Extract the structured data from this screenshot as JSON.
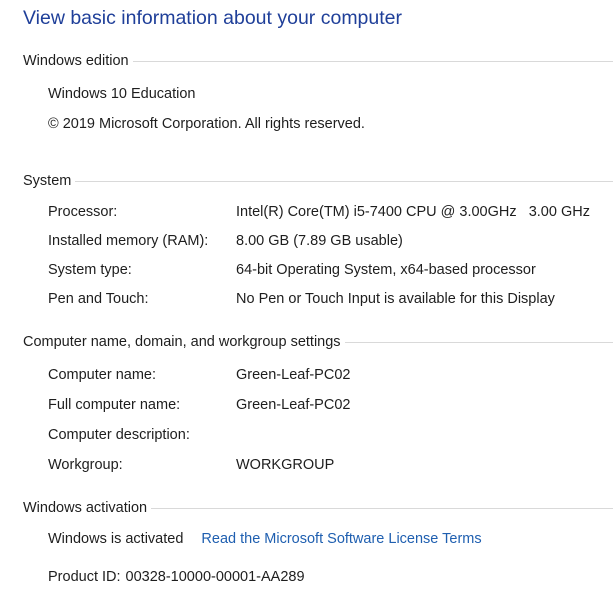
{
  "page_title": "View basic information about your computer",
  "windows_edition": {
    "header": "Windows edition",
    "edition": "Windows 10 Education",
    "copyright": "© 2019 Microsoft Corporation. All rights reserved."
  },
  "system": {
    "header": "System",
    "rows": [
      {
        "key": "Processor:",
        "value": "Intel(R) Core(TM) i5-7400 CPU @ 3.00GHz   3.00 GHz"
      },
      {
        "key": "Installed memory (RAM):",
        "value": "8.00 GB (7.89 GB usable)"
      },
      {
        "key": "System type:",
        "value": "64-bit Operating System, x64-based processor"
      },
      {
        "key": "Pen and Touch:",
        "value": "No Pen or Touch Input is available for this Display"
      }
    ]
  },
  "computer_name": {
    "header": "Computer name, domain, and workgroup settings",
    "rows": [
      {
        "key": "Computer name:",
        "value": "Green-Leaf-PC02"
      },
      {
        "key": "Full computer name:",
        "value": "Green-Leaf-PC02"
      },
      {
        "key": "Computer description:",
        "value": ""
      },
      {
        "key": "Workgroup:",
        "value": "WORKGROUP"
      }
    ]
  },
  "activation": {
    "header": "Windows activation",
    "status": "Windows is activated",
    "license_link": "Read the Microsoft Software License Terms",
    "product_id_label": "Product ID:",
    "product_id": "00328-10000-00001-AA289"
  },
  "colors": {
    "title": "#1f3f99",
    "link": "#1f5fb0",
    "rule": "#d9d9d9"
  }
}
